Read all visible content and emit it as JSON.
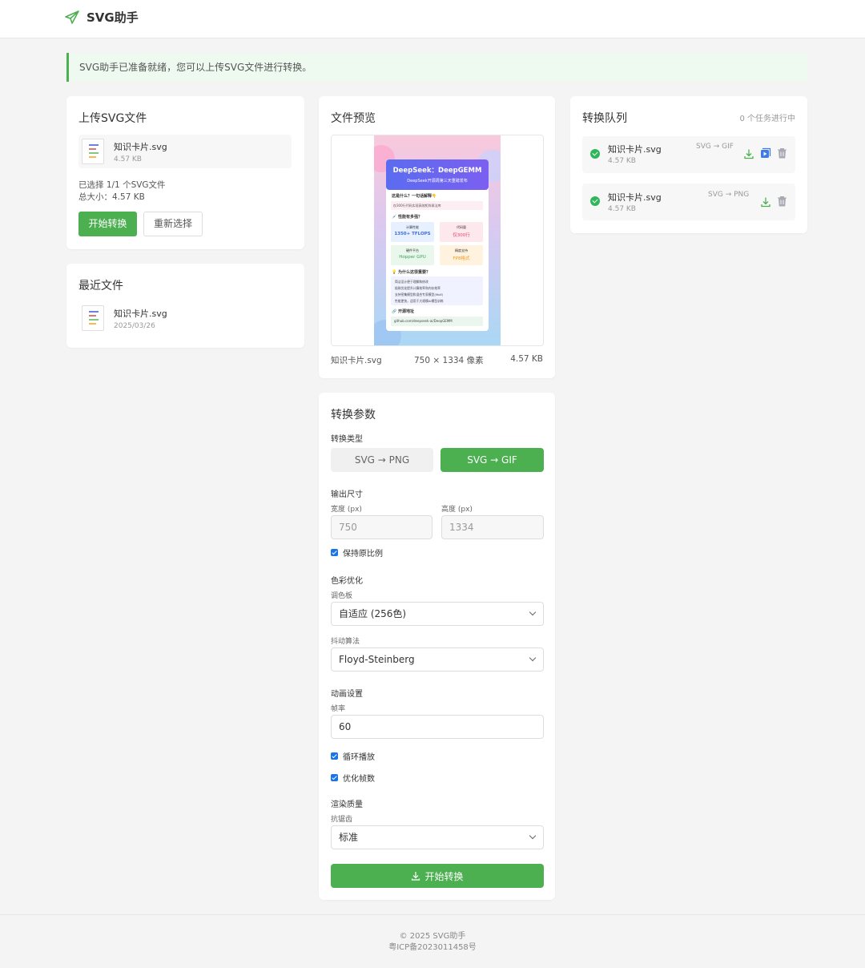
{
  "header": {
    "app_name": "SVG助手"
  },
  "alert": {
    "message": "SVG助手已准备就绪，您可以上传SVG文件进行转换。"
  },
  "upload": {
    "title": "上传SVG文件",
    "file": {
      "name": "知识卡片.svg",
      "size": "4.57 KB"
    },
    "selected_text": "已选择 1/1 个SVG文件",
    "total_size_text": "总大小：4.57 KB",
    "start_label": "开始转换",
    "reselect_label": "重新选择"
  },
  "recent": {
    "title": "最近文件",
    "file": {
      "name": "知识卡片.svg",
      "date": "2025/03/26"
    }
  },
  "preview": {
    "title": "文件预览",
    "filename": "知识卡片.svg",
    "dimensions": "750 × 1334 像素",
    "size": "4.57 KB",
    "card": {
      "title": "DeepSeek：DeepGEMM",
      "subtitle": "DeepSeek开源周第三天重磅发布",
      "q1": "这是什么？一句话解释👇",
      "q1_text": "仅300行代码实现高效矩阵乘法库",
      "q2": "💉 性能有多强？",
      "stat1_label": "计算性能",
      "stat1_value": "1350+ TFLOPS",
      "stat2_label": "代码量",
      "stat2_value": "仅300行",
      "stat3_label": "硬件平台",
      "stat3_value": "Hopper GPU",
      "stat4_label": "精度支持",
      "stat4_value": "FP8格式",
      "q3": "💡 为什么这很重要？",
      "bullets": [
        "简洁设计便于理解和修改",
        "极致优化提升计算效率和内存效率",
        "支持密集模型和混合专家模型(MoE)",
        "性能更快，适用于大规模AI模型训练"
      ],
      "link_label": "🔗 开源地址",
      "link": "github.com/deepseek-ai/DeepGEMM"
    }
  },
  "params": {
    "title": "转换参数",
    "type_label": "转换类型",
    "type_png": "SVG → PNG",
    "type_gif": "SVG → GIF",
    "size_label": "输出尺寸",
    "width_label": "宽度 (px)",
    "width_value": "750",
    "height_label": "高度 (px)",
    "height_value": "1334",
    "keep_ratio": "保持原比例",
    "color_label": "色彩优化",
    "palette_label": "调色板",
    "palette_value": "自适应 (256色)",
    "dither_label": "抖动算法",
    "dither_value": "Floyd-Steinberg",
    "anim_label": "动画设置",
    "fps_label": "帧率",
    "fps_value": "60",
    "loop_label": "循环播放",
    "optimize_label": "优化帧数",
    "quality_label": "渲染质量",
    "aa_label": "抗锯齿",
    "aa_value": "标准",
    "submit_label": "开始转换"
  },
  "queue": {
    "title": "转换队列",
    "status": "0 个任务进行中",
    "tasks": [
      {
        "name": "知识卡片.svg",
        "size": "4.57 KB",
        "type": "SVG → GIF"
      },
      {
        "name": "知识卡片.svg",
        "size": "4.57 KB",
        "type": "SVG → PNG"
      }
    ]
  },
  "footer": {
    "copyright": "© 2025 SVG助手",
    "icp": "粤ICP备2023011458号"
  },
  "colors": {
    "accent": "#4caf50",
    "checkbox": "#1a73e8",
    "success": "#2fb65b"
  }
}
